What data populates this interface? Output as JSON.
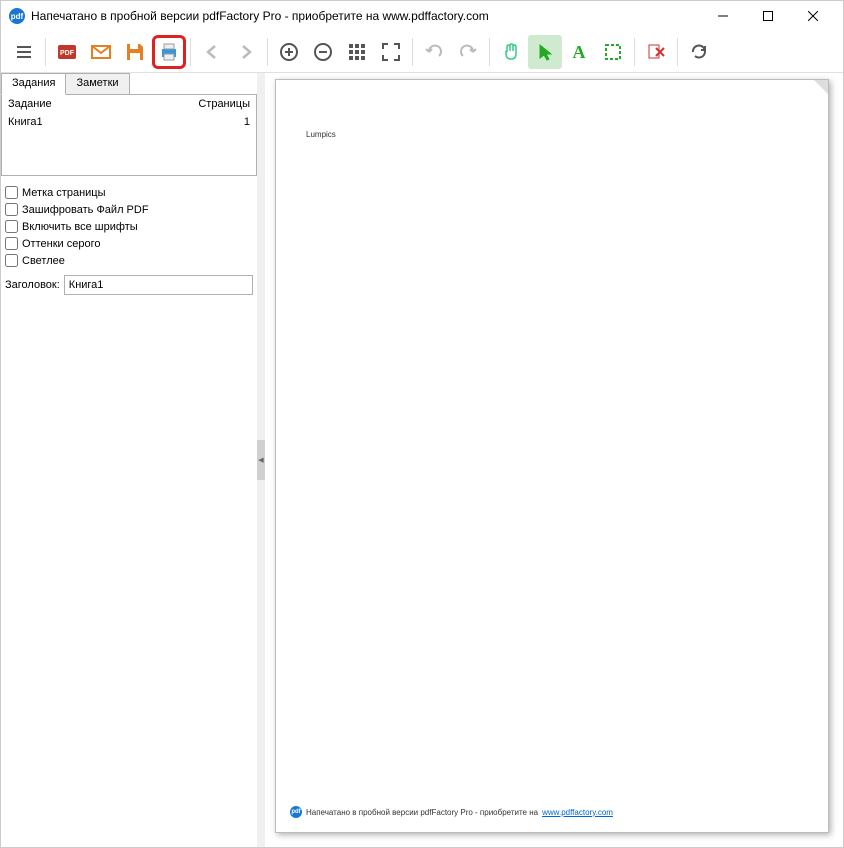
{
  "titlebar": {
    "icon_text": "pdf",
    "title": "Напечатано в пробной версии pdfFactory Pro - приобретите на www.pdffactory.com"
  },
  "toolbar": {
    "menu": "menu",
    "pdf": "pdf",
    "email": "email",
    "save": "save",
    "print": "print",
    "back": "back",
    "forward": "forward",
    "zoomin": "zoomin",
    "zoomout": "zoomout",
    "grid": "grid",
    "fullscreen": "fullscreen",
    "undo": "undo",
    "redo": "redo",
    "hand": "hand",
    "select": "select",
    "text": "text",
    "crop": "crop",
    "delete": "delete",
    "refresh": "refresh"
  },
  "sidebar": {
    "tabs": [
      {
        "label": "Задания",
        "active": true
      },
      {
        "label": "Заметки",
        "active": false
      }
    ],
    "job_header": {
      "name": "Задание",
      "pages": "Страницы"
    },
    "jobs": [
      {
        "name": "Книга1",
        "pages": "1"
      }
    ],
    "options": [
      {
        "label": "Метка страницы",
        "checked": false
      },
      {
        "label": "Зашифровать Файл PDF",
        "checked": false
      },
      {
        "label": "Включить все шрифты",
        "checked": false
      },
      {
        "label": "Оттенки серого",
        "checked": false
      },
      {
        "label": "Светлее",
        "checked": false
      }
    ],
    "title_label": "Заголовок:",
    "title_value": "Книга1"
  },
  "preview": {
    "content": "Lumpics",
    "footer_icon": "pdf",
    "footer_text": "Напечатано в пробной версии pdfFactory Pro - приобретите на ",
    "footer_link": "www.pdffactory.com"
  }
}
